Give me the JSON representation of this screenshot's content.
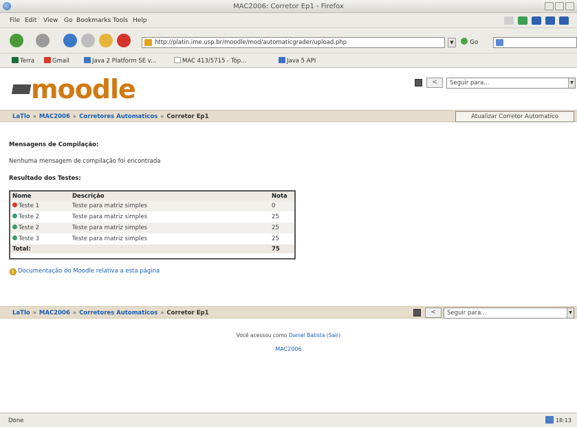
{
  "window": {
    "title": "MAC2006: Corretor Ep1 - Firefox"
  },
  "menu": [
    "File",
    "Edit",
    "View",
    "Go",
    "Bookmarks",
    "Tools",
    "Help"
  ],
  "nav": {
    "url": "http://platin.ime.usp.br/moodle/mod/automaticgrader/upload.php",
    "go_label": "Go"
  },
  "bookmarks": [
    {
      "label": "Terra",
      "color": "#1c6b3a"
    },
    {
      "label": "Gmail",
      "color": "#d33a2c"
    },
    {
      "label": "Java 2 Platform SE v...",
      "color": "#3f73c4"
    },
    {
      "label": "MAC 413/5715 - Tóp...",
      "color": "#dddddd"
    },
    {
      "label": "Java 5 API",
      "color": "#3f73c4"
    }
  ],
  "header": {
    "logo": "moodle",
    "prev_label": "<",
    "jump_placeholder": "Seguir para..."
  },
  "breadcrumb": {
    "home": "LaTlo",
    "course": "MAC2006",
    "section": "Corretores Automaticos",
    "current": "Corretor Ep1",
    "sep": "»"
  },
  "update_button": "Atualizar Corretor Automatico",
  "compile": {
    "heading": "Mensagens de Compilação:",
    "text": "Nenhuma mensagem de compilação foi encontrada"
  },
  "results": {
    "heading": "Resultado dos Testes:",
    "columns": [
      "Nome",
      "Descrição",
      "Nota"
    ],
    "rows": [
      {
        "name": "Teste 1",
        "desc": "Teste para matriz simples",
        "grade": "0",
        "status": "fail"
      },
      {
        "name": "Teste 2",
        "desc": "Teste para matriz simples",
        "grade": "25",
        "status": "pass"
      },
      {
        "name": "Teste 2",
        "desc": "Teste para matriz simples",
        "grade": "25",
        "status": "pass"
      },
      {
        "name": "Teste 3",
        "desc": "Teste para matriz simples",
        "grade": "25",
        "status": "pass"
      }
    ],
    "total_label": "Total:",
    "total": "75"
  },
  "status_colors": {
    "fail": "#d23b2e",
    "pass": "#3a9c6a"
  },
  "doc_link": "Documentação do Moodle relativa a esta página",
  "footer": {
    "login_prefix": "Você acessou como",
    "user": "Daniel Batista",
    "logout": "(Sair)",
    "home_link": "MAC2006"
  },
  "statusbar": {
    "text": "Done",
    "clock": "18:13"
  }
}
